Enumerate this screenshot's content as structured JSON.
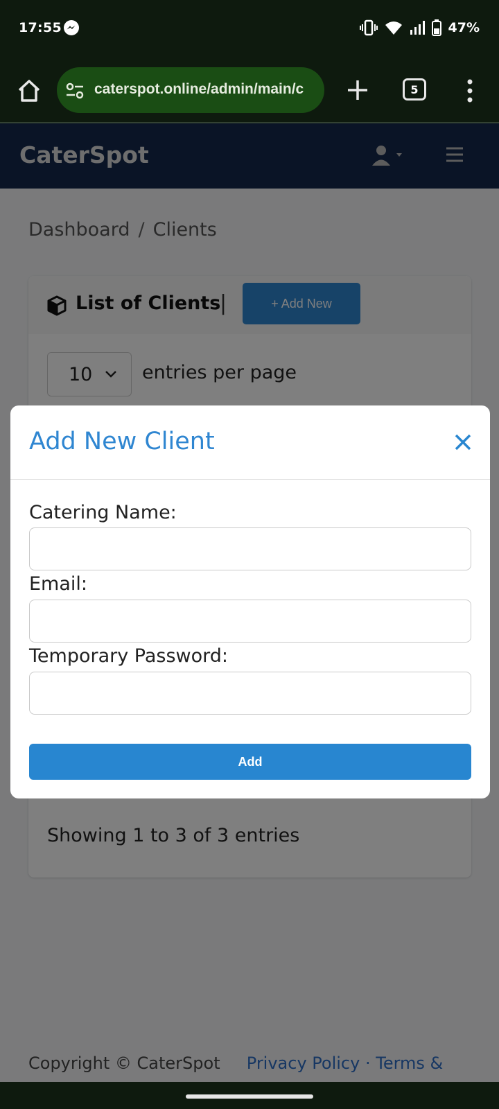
{
  "status_bar": {
    "time": "17:55",
    "battery_percent": "47%",
    "icons": [
      "messenger-icon",
      "vibrate-icon",
      "wifi-icon",
      "signal-icon",
      "battery-icon"
    ]
  },
  "browser": {
    "url": "caterspot.online/admin/main/c",
    "tab_count": "5",
    "icons": [
      "home-icon",
      "site-settings-icon",
      "new-tab-icon",
      "tab-switcher-icon",
      "more-menu-icon"
    ]
  },
  "site": {
    "brand": "CaterSpot",
    "breadcrumb": [
      "Dashboard",
      "Clients"
    ],
    "breadcrumb_separator": "/",
    "card_title": "List of Clients",
    "card_divider": "|",
    "add_new_label": "+ Add New",
    "entries_value": "10",
    "entries_label": "entries per page",
    "showing_text": "Showing 1 to 3 of 3 entries",
    "footer": {
      "copyright": "Copyright © CaterSpot",
      "privacy": "Privacy Policy",
      "dot": "·",
      "terms": "Terms &"
    }
  },
  "modal": {
    "title": "Add New Client",
    "fields": [
      {
        "label": "Catering Name:",
        "value": "",
        "placeholder": ""
      },
      {
        "label": "Email:",
        "value": "",
        "placeholder": ""
      },
      {
        "label": "Temporary Password:",
        "value": "",
        "placeholder": ""
      }
    ],
    "submit_label": "Add"
  },
  "colors": {
    "accent": "#2886d0",
    "navbar": "#14294d",
    "status_bar": "#0e1a0e",
    "omnibox": "#1a4d14"
  }
}
